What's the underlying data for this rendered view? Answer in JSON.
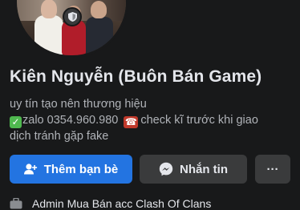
{
  "profile": {
    "name": "Kiên Nguyễn (Buôn Bán Game)",
    "bio_line1": "uy tín tạo nên thương hiệu",
    "bio_line2_a": "zalo 0354.960.980",
    "bio_line2_b": "check kĩ trước khi giao",
    "bio_line3": "dịch tránh gặp fake"
  },
  "actions": {
    "add_friend_label": "Thêm bạn bè",
    "message_label": "Nhắn tin",
    "more_label": "···"
  },
  "info": {
    "work_text": "Admin Mua Bán acc Clash Of Clans"
  },
  "colors": {
    "background": "#18191a",
    "primary_button": "#2374e1",
    "secondary_button": "#3a3b3c",
    "text_primary": "#e4e6eb",
    "text_secondary": "#b0b3b8"
  },
  "icons": {
    "badge": "shield-icon",
    "add_friend": "add-person-icon",
    "message": "messenger-icon",
    "more": "more-dots-icon",
    "work": "briefcase-icon",
    "check_emoji": "check-mark-emoji-icon",
    "phone_emoji": "telephone-emoji-icon"
  }
}
